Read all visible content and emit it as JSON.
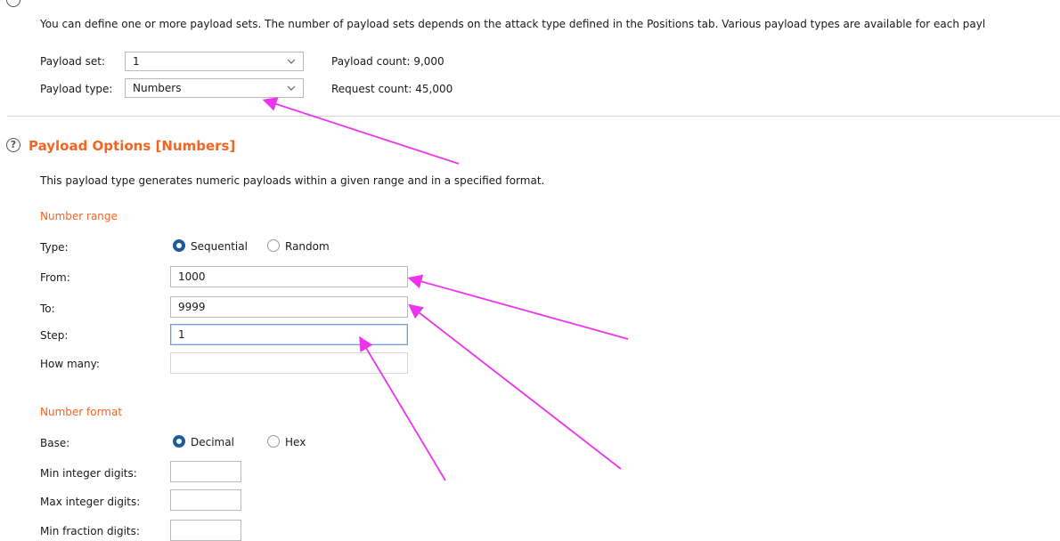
{
  "payload_sets": {
    "description": "You can define one or more payload sets. The number of payload sets depends on the attack type defined in the Positions tab. Various payload types are available for each payl",
    "payload_set_label": "Payload set:",
    "payload_set_value": "1",
    "payload_count": "Payload count: 9,000",
    "payload_type_label": "Payload type:",
    "payload_type_value": "Numbers",
    "request_count": "Request count: 45,000"
  },
  "payload_options": {
    "title": "Payload Options [Numbers]",
    "description": "This payload type generates numeric payloads within a given range and in a specified format.",
    "number_range": {
      "heading": "Number range",
      "type_label": "Type:",
      "type_options": [
        "Sequential",
        "Random"
      ],
      "type_selected": "Sequential",
      "from_label": "From:",
      "from_value": "1000",
      "to_label": "To:",
      "to_value": "9999",
      "step_label": "Step:",
      "step_value": "1",
      "how_many_label": "How many:",
      "how_many_value": ""
    },
    "number_format": {
      "heading": "Number format",
      "base_label": "Base:",
      "base_options": [
        "Decimal",
        "Hex"
      ],
      "base_selected": "Decimal",
      "min_int_label": "Min integer digits:",
      "max_int_label": "Max integer digits:",
      "min_frac_label": "Min fraction digits:"
    }
  },
  "colors": {
    "accent_orange": "#f26522",
    "radio_selected": "#1f5aa0",
    "annotation_arrow": "#ee33ee"
  },
  "icons": [
    "help-icon",
    "chevron-down-icon"
  ]
}
